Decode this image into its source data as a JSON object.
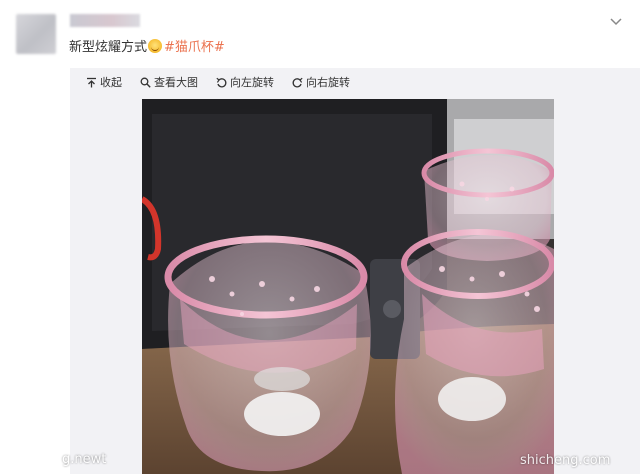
{
  "post": {
    "text_main": "新型炫耀方式",
    "emoji_icon": "grinning-face-icon",
    "topic": "#猫爪杯#"
  },
  "toolbar": {
    "collapse": {
      "label": "收起",
      "icon": "collapse-up-icon"
    },
    "view_large": {
      "label": "查看大图",
      "icon": "magnifier-icon"
    },
    "rotate_left": {
      "label": "向左旋转",
      "icon": "rotate-left-icon"
    },
    "rotate_right": {
      "label": "向右旋转",
      "icon": "rotate-right-icon"
    }
  },
  "photo": {
    "subject": "cat-paw-glass-cups-photo"
  },
  "watermarks": {
    "left": "g.newt",
    "right": "shicheng.com"
  }
}
